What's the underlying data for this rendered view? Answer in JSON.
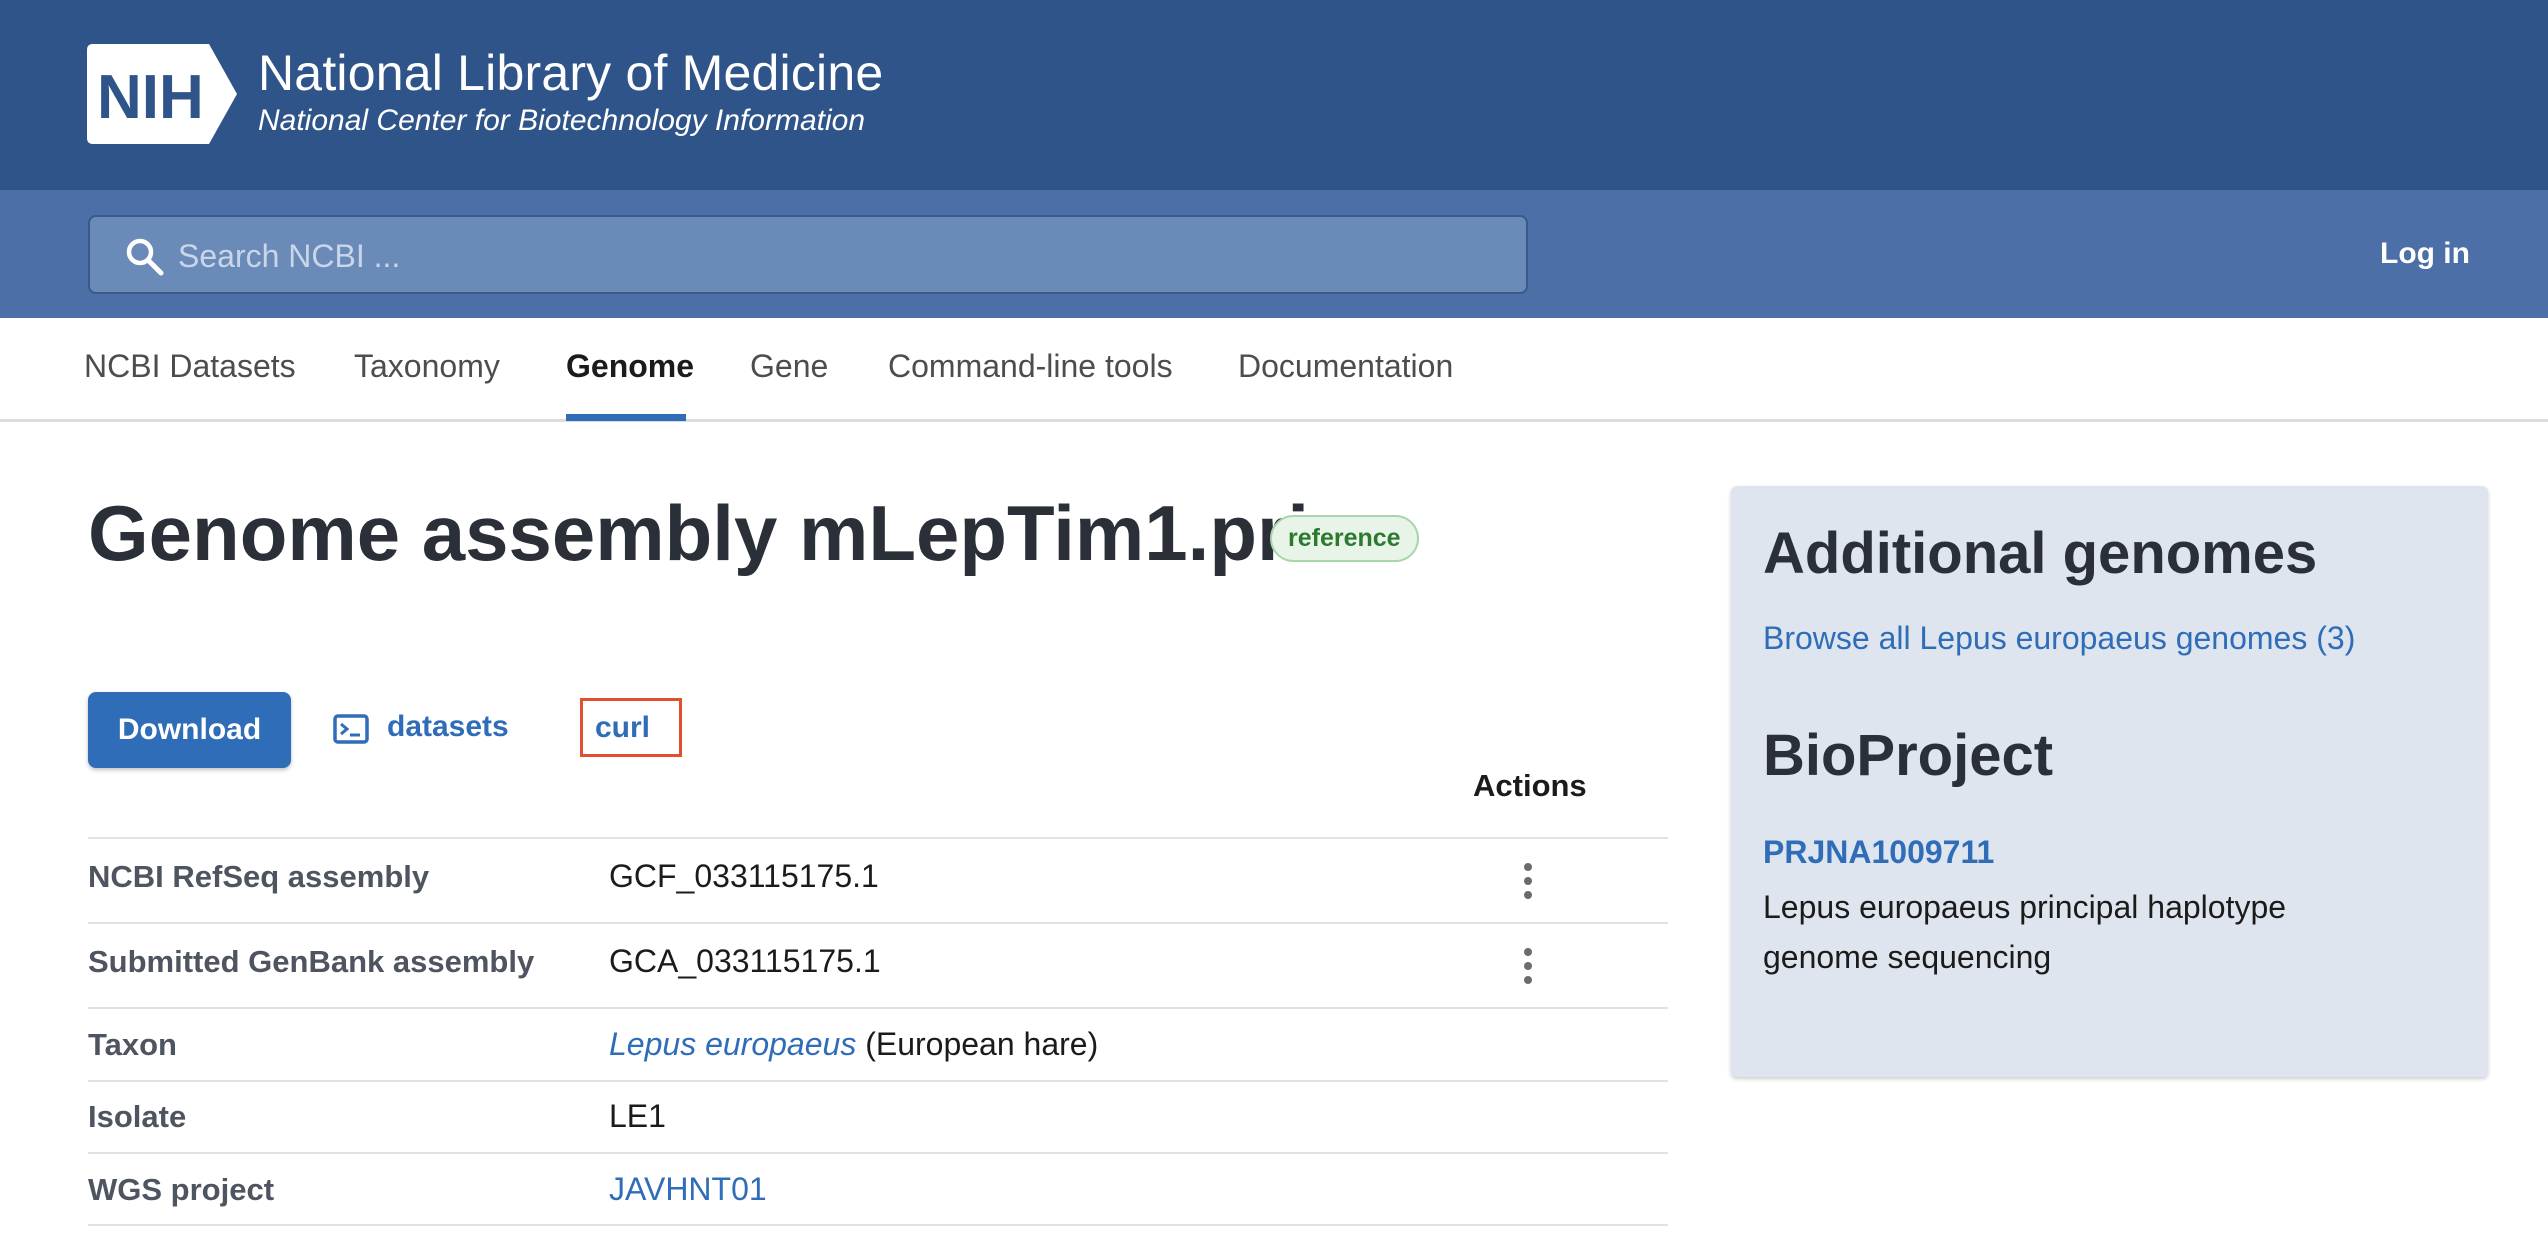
{
  "header": {
    "logo_text": "NIH",
    "title": "National Library of Medicine",
    "subtitle": "National Center for Biotechnology Information"
  },
  "search": {
    "placeholder": "Search NCBI ...",
    "icon": "search-icon"
  },
  "login_label": "Log in",
  "nav": {
    "tabs": [
      {
        "label": "NCBI Datasets"
      },
      {
        "label": "Taxonomy"
      },
      {
        "label": "Genome",
        "active": true
      },
      {
        "label": "Gene"
      },
      {
        "label": "Command-line tools"
      },
      {
        "label": "Documentation"
      }
    ]
  },
  "page": {
    "title": "Genome assembly mLepTim1.pri",
    "badge": "reference"
  },
  "actions": {
    "download_label": "Download",
    "datasets_label": "datasets",
    "curl_label": "curl",
    "column_header": "Actions"
  },
  "table": {
    "rows": [
      {
        "label": "NCBI RefSeq assembly",
        "value": "GCF_033115175.1"
      },
      {
        "label": "Submitted GenBank assembly",
        "value": "GCA_033115175.1"
      },
      {
        "label": "Taxon",
        "value_link": "Lepus europaeus",
        "value_suffix": " (European hare)"
      },
      {
        "label": "Isolate",
        "value": "LE1"
      },
      {
        "label": "WGS project",
        "value": "JAVHNT01"
      }
    ]
  },
  "sidebar": {
    "additional_title": "Additional genomes",
    "browse_link": "Browse all Lepus europaeus genomes (3)",
    "bioproject_title": "BioProject",
    "bioproject_id": "PRJNA1009711",
    "bioproject_desc": "Lepus europaeus principal haplotype genome sequencing"
  },
  "colors": {
    "banner": "#2f5489",
    "search_band": "#4b6fa6",
    "accent": "#2f6db8",
    "highlight_box": "#e0502f",
    "badge_green": "#2b7a2f"
  }
}
